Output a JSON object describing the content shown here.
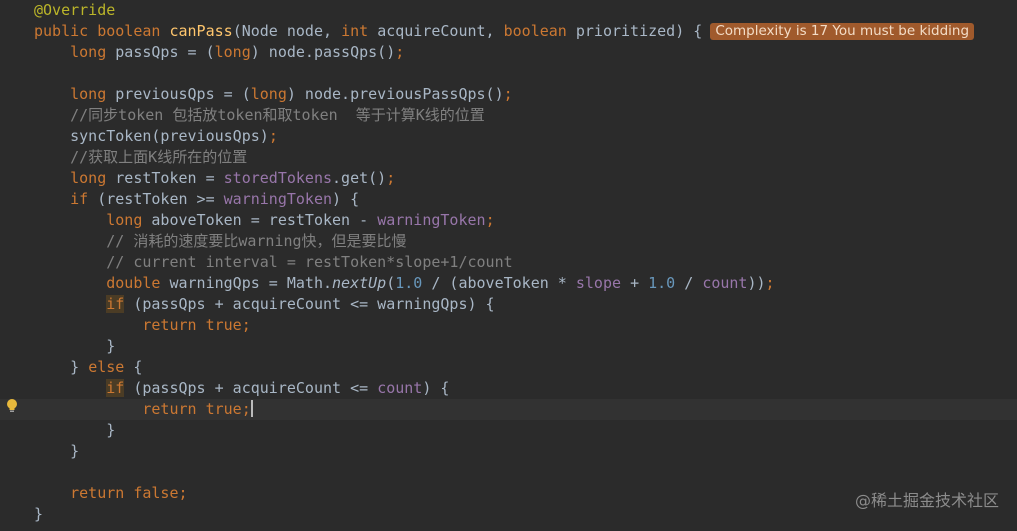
{
  "badge": "Complexity is 17 You must be kidding",
  "watermark": "@稀土掘金技术社区",
  "lines": [
    [
      {
        "t": "@Override",
        "c": "anno"
      }
    ],
    [
      {
        "t": "public boolean ",
        "c": "kw"
      },
      {
        "t": "canPass",
        "c": "fn"
      },
      {
        "t": "(Node node, ",
        "c": "plain"
      },
      {
        "t": "int ",
        "c": "kw"
      },
      {
        "t": "acquireCount, ",
        "c": "plain"
      },
      {
        "t": "boolean ",
        "c": "kw"
      },
      {
        "t": "prioritized) {",
        "c": "plain"
      }
    ],
    [
      {
        "t": "    "
      },
      {
        "t": "long ",
        "c": "kw"
      },
      {
        "t": "passQps = (",
        "c": "plain"
      },
      {
        "t": "long",
        "c": "kw"
      },
      {
        "t": ") node.passQps()",
        "c": "plain"
      },
      {
        "t": ";",
        "c": "kw"
      }
    ],
    [],
    [
      {
        "t": "    "
      },
      {
        "t": "long ",
        "c": "kw"
      },
      {
        "t": "previousQps = (",
        "c": "plain"
      },
      {
        "t": "long",
        "c": "kw"
      },
      {
        "t": ") node.previousPassQps()",
        "c": "plain"
      },
      {
        "t": ";",
        "c": "kw"
      }
    ],
    [
      {
        "t": "    "
      },
      {
        "t": "//同步token 包括放token和取token  等于计算K线的位置",
        "c": "comment"
      }
    ],
    [
      {
        "t": "    "
      },
      {
        "t": "syncToken(previousQps)",
        "c": "plain"
      },
      {
        "t": ";",
        "c": "kw"
      }
    ],
    [
      {
        "t": "    "
      },
      {
        "t": "//获取上面K线所在的位置",
        "c": "comment"
      }
    ],
    [
      {
        "t": "    "
      },
      {
        "t": "long ",
        "c": "kw"
      },
      {
        "t": "restToken = ",
        "c": "plain"
      },
      {
        "t": "storedTokens",
        "c": "field"
      },
      {
        "t": ".get()",
        "c": "plain"
      },
      {
        "t": ";",
        "c": "kw"
      }
    ],
    [
      {
        "t": "    "
      },
      {
        "t": "if ",
        "c": "kw"
      },
      {
        "t": "(restToken >= ",
        "c": "plain"
      },
      {
        "t": "warningToken",
        "c": "field"
      },
      {
        "t": ") {",
        "c": "plain"
      }
    ],
    [
      {
        "t": "        "
      },
      {
        "t": "long ",
        "c": "kw"
      },
      {
        "t": "aboveToken = restToken - ",
        "c": "plain"
      },
      {
        "t": "warningToken",
        "c": "field"
      },
      {
        "t": ";",
        "c": "kw"
      }
    ],
    [
      {
        "t": "        "
      },
      {
        "t": "// 消耗的速度要比warning快，但是要比慢",
        "c": "comment"
      }
    ],
    [
      {
        "t": "        "
      },
      {
        "t": "// current interval = restToken*slope+1/count",
        "c": "comment"
      }
    ],
    [
      {
        "t": "        "
      },
      {
        "t": "double ",
        "c": "kw"
      },
      {
        "t": "warningQps = Math.",
        "c": "plain"
      },
      {
        "t": "nextUp",
        "c": "italic"
      },
      {
        "t": "(",
        "c": "plain"
      },
      {
        "t": "1.0 ",
        "c": "num"
      },
      {
        "t": "/ (aboveToken * ",
        "c": "plain"
      },
      {
        "t": "slope ",
        "c": "field"
      },
      {
        "t": "+ ",
        "c": "plain"
      },
      {
        "t": "1.0 ",
        "c": "num"
      },
      {
        "t": "/ ",
        "c": "plain"
      },
      {
        "t": "count",
        "c": "field"
      },
      {
        "t": "))",
        "c": "plain"
      },
      {
        "t": ";",
        "c": "kw"
      }
    ],
    [
      {
        "t": "        "
      },
      {
        "t": "if",
        "c": "kw",
        "hl": true
      },
      {
        "t": " (passQps + acquireCount <= warningQps) {",
        "c": "plain"
      }
    ],
    [
      {
        "t": "            "
      },
      {
        "t": "return true",
        "c": "kw"
      },
      {
        "t": ";",
        "c": "kw"
      }
    ],
    [
      {
        "t": "        "
      },
      {
        "t": "}",
        "c": "plain"
      }
    ],
    [
      {
        "t": "    "
      },
      {
        "t": "} ",
        "c": "plain"
      },
      {
        "t": "else ",
        "c": "kw"
      },
      {
        "t": "{",
        "c": "plain"
      }
    ],
    [
      {
        "t": "        "
      },
      {
        "t": "if",
        "c": "kw",
        "hl": true
      },
      {
        "t": " (passQps + acquireCount <= ",
        "c": "plain"
      },
      {
        "t": "count",
        "c": "field"
      },
      {
        "t": ") {",
        "c": "plain"
      }
    ],
    [
      {
        "t": "            "
      },
      {
        "t": "return true",
        "c": "kw"
      },
      {
        "t": ";",
        "c": "kw"
      }
    ],
    [
      {
        "t": "        "
      },
      {
        "t": "}",
        "c": "plain"
      }
    ],
    [
      {
        "t": "    "
      },
      {
        "t": "}",
        "c": "plain"
      }
    ],
    [],
    [
      {
        "t": "    "
      },
      {
        "t": "return false",
        "c": "kw"
      },
      {
        "t": ";",
        "c": "kw"
      }
    ],
    [
      {
        "t": "}",
        "c": "plain"
      }
    ]
  ]
}
